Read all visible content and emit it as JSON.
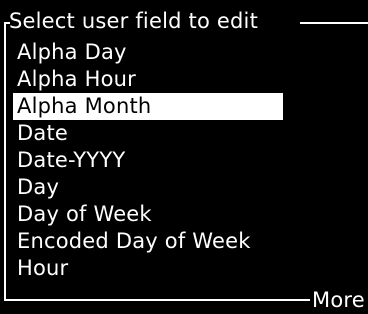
{
  "screen": {
    "title": "Select user field to edit",
    "items": [
      {
        "label": "Alpha Day",
        "selected": false
      },
      {
        "label": "Alpha Hour",
        "selected": false
      },
      {
        "label": "Alpha Month",
        "selected": true
      },
      {
        "label": "Date",
        "selected": false
      },
      {
        "label": "Date-YYYY",
        "selected": false
      },
      {
        "label": "Day",
        "selected": false
      },
      {
        "label": "Day of Week",
        "selected": false
      },
      {
        "label": "Encoded Day of Week",
        "selected": false
      },
      {
        "label": "Hour",
        "selected": false
      }
    ],
    "more_label": "More"
  },
  "colors": {
    "background": "#000000",
    "foreground": "#ffffff"
  }
}
